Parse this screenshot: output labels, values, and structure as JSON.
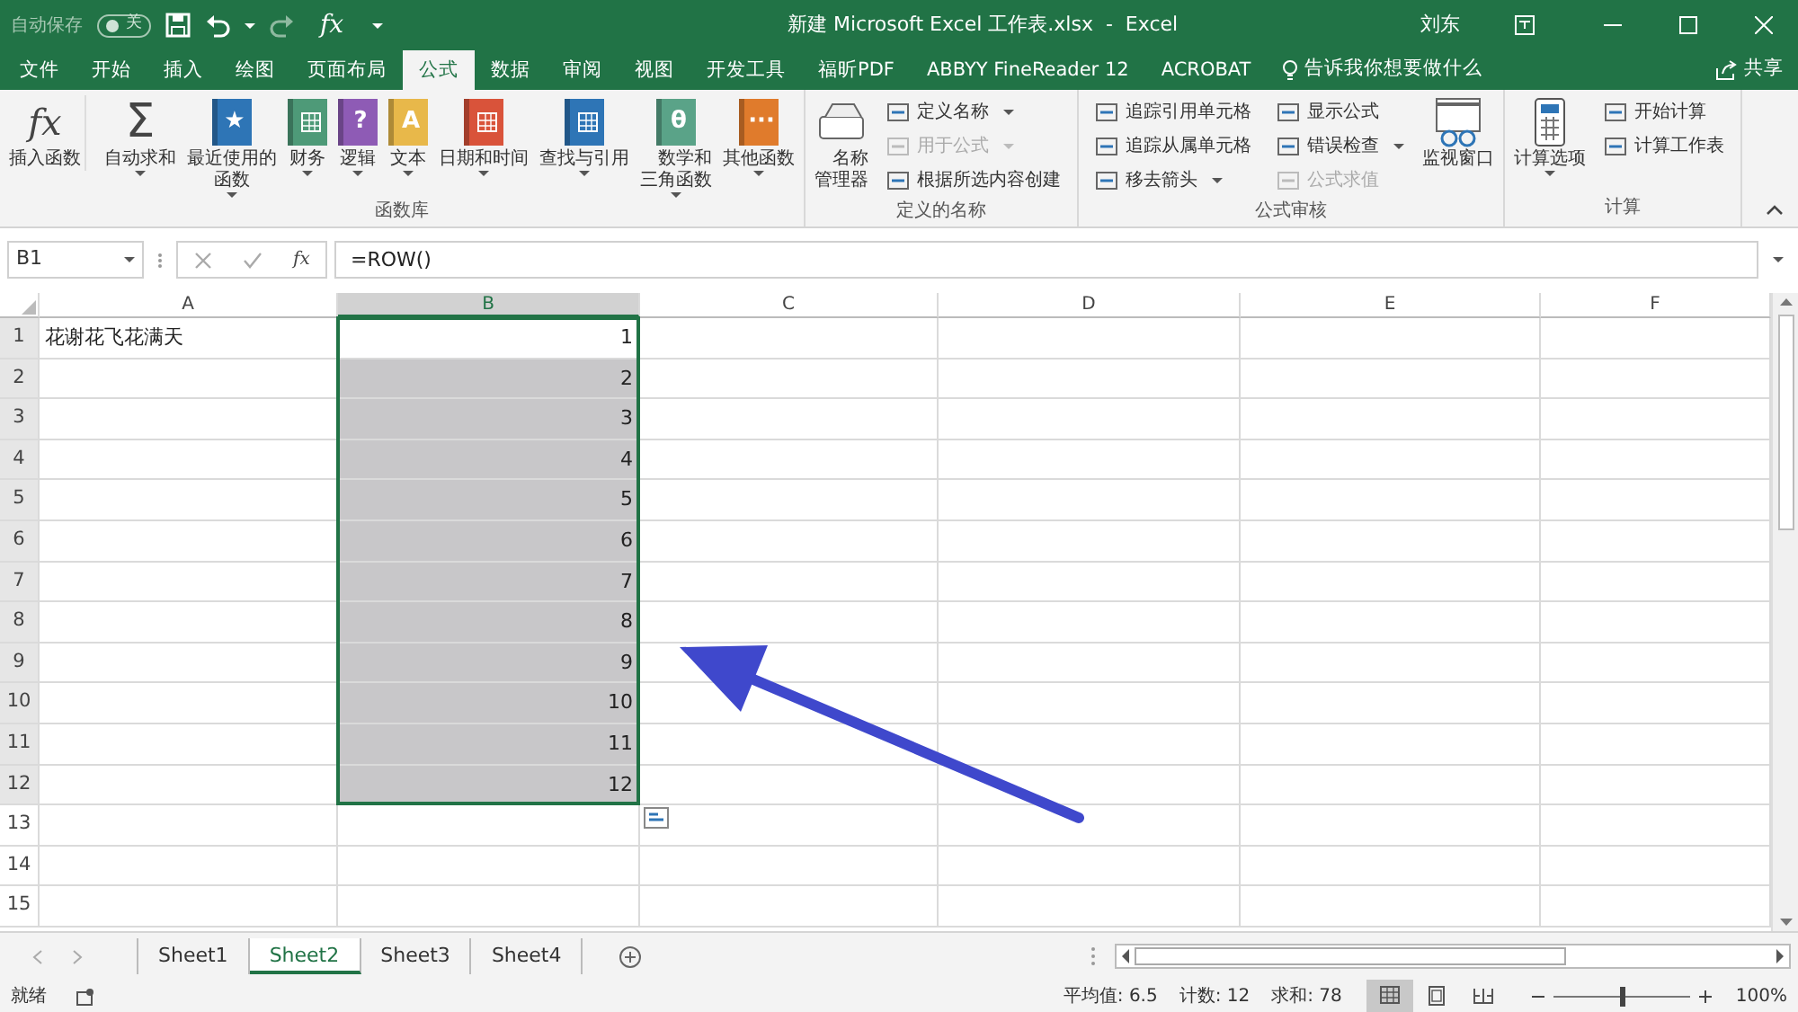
{
  "title_bar": {
    "autosave": {
      "label": "自动保存",
      "on": false,
      "state_text": "关"
    },
    "quick_fx": "fx",
    "title": "新建 Microsoft Excel 工作表.xlsx  -  Excel",
    "user": "刘东"
  },
  "ribbon_tabs": [
    {
      "label": "文件",
      "selected": false
    },
    {
      "label": "开始",
      "selected": false
    },
    {
      "label": "插入",
      "selected": false
    },
    {
      "label": "绘图",
      "selected": false
    },
    {
      "label": "页面布局",
      "selected": false
    },
    {
      "label": "公式",
      "selected": true
    },
    {
      "label": "数据",
      "selected": false
    },
    {
      "label": "审阅",
      "selected": false
    },
    {
      "label": "视图",
      "selected": false
    },
    {
      "label": "开发工具",
      "selected": false
    },
    {
      "label": "福昕PDF",
      "selected": false
    },
    {
      "label": "ABBYY FineReader 12",
      "selected": false
    },
    {
      "label": "ACROBAT",
      "selected": false
    }
  ],
  "tell_me": "告诉我你想要做什么",
  "share": "共享",
  "ribbon_groups": [
    {
      "label": "函数库",
      "items": [
        {
          "kind": "symbol",
          "glyph": "fx",
          "label": "插入函数",
          "dropdown": false
        },
        {
          "kind": "symbol",
          "glyph": "Σ",
          "label": "自动求和",
          "dropdown": true
        },
        {
          "kind": "book",
          "glyph": "★",
          "color": "#2e75b6",
          "label": "最近使用的函数",
          "dropdown": true
        },
        {
          "kind": "book",
          "color": "#4e9a78",
          "label": "财务",
          "dropdown": true
        },
        {
          "kind": "book",
          "glyph": "?",
          "color": "#8e5bb5",
          "label": "逻辑",
          "dropdown": true
        },
        {
          "kind": "book",
          "glyph": "A",
          "color": "#e8b84a",
          "label": "文本",
          "dropdown": true
        },
        {
          "kind": "book",
          "color": "#d9533a",
          "label": "日期和时间",
          "dropdown": true
        },
        {
          "kind": "book",
          "color": "#2e75b6",
          "label": "查找与引用",
          "dropdown": true
        },
        {
          "kind": "book",
          "glyph": "θ",
          "color": "#5aa388",
          "label": "数学和三角函数",
          "dropdown": true
        },
        {
          "kind": "book",
          "glyph": "···",
          "color": "#e07b2c",
          "label": "其他函数",
          "dropdown": true
        }
      ]
    },
    {
      "label": "定义的名称",
      "items": [
        {
          "kind": "drawer",
          "label": "名称管理器",
          "dropdown": false
        },
        {
          "kind": "stack",
          "items": [
            {
              "label": "定义名称",
              "dropdown": true,
              "disabled": false
            },
            {
              "label": "用于公式",
              "dropdown": true,
              "disabled": true
            },
            {
              "label": "根据所选内容创建",
              "dropdown": false,
              "disabled": false
            }
          ]
        }
      ]
    },
    {
      "label": "公式审核",
      "items": [
        {
          "kind": "stack",
          "items": [
            {
              "label": "追踪引用单元格",
              "dropdown": false,
              "disabled": false
            },
            {
              "label": "追踪从属单元格",
              "dropdown": false,
              "disabled": false
            },
            {
              "label": "移去箭头",
              "dropdown": true,
              "disabled": false
            }
          ]
        },
        {
          "kind": "stack",
          "items": [
            {
              "label": "显示公式",
              "dropdown": false,
              "disabled": false
            },
            {
              "label": "错误检查",
              "dropdown": true,
              "disabled": false
            },
            {
              "label": "公式求值",
              "dropdown": false,
              "disabled": true
            }
          ]
        },
        {
          "kind": "window",
          "label": "监视窗口",
          "dropdown": false
        }
      ]
    },
    {
      "label": "计算",
      "items": [
        {
          "kind": "calc",
          "label": "计算选项",
          "dropdown": true
        },
        {
          "kind": "stack",
          "items": [
            {
              "label": "开始计算",
              "dropdown": false,
              "disabled": false
            },
            {
              "label": "计算工作表",
              "dropdown": false,
              "disabled": false
            }
          ]
        }
      ]
    }
  ],
  "formula_bar": {
    "name_box": "B1",
    "fx": "fx",
    "formula": "=ROW()"
  },
  "columns": [
    {
      "label": "A",
      "selected": false
    },
    {
      "label": "B",
      "selected": true
    },
    {
      "label": "C",
      "selected": false
    },
    {
      "label": "D",
      "selected": false
    },
    {
      "label": "E",
      "selected": false
    },
    {
      "label": "F",
      "selected": false
    }
  ],
  "rows": [
    {
      "header": "1",
      "a": "花谢花飞花满天",
      "b": "1",
      "selected": true,
      "active": true
    },
    {
      "header": "2",
      "b": "2",
      "selected": true,
      "active": false
    },
    {
      "header": "3",
      "b": "3",
      "selected": true,
      "active": false
    },
    {
      "header": "4",
      "b": "4",
      "selected": true,
      "active": false
    },
    {
      "header": "5",
      "b": "5",
      "selected": true,
      "active": false
    },
    {
      "header": "6",
      "b": "6",
      "selected": true,
      "active": false
    },
    {
      "header": "7",
      "b": "7",
      "selected": true,
      "active": false
    },
    {
      "header": "8",
      "b": "8",
      "selected": true,
      "active": false
    },
    {
      "header": "9",
      "b": "9",
      "selected": true,
      "active": false
    },
    {
      "header": "10",
      "b": "10",
      "selected": true,
      "active": false
    },
    {
      "header": "11",
      "b": "11",
      "selected": true,
      "active": false
    },
    {
      "header": "12",
      "b": "12",
      "selected": true,
      "active": false
    },
    {
      "header": "13",
      "selected": false,
      "active": false
    },
    {
      "header": "14",
      "selected": false,
      "active": false
    },
    {
      "header": "15",
      "selected": false,
      "active": false
    }
  ],
  "sheets": [
    {
      "label": "Sheet1",
      "selected": false
    },
    {
      "label": "Sheet2",
      "selected": true
    },
    {
      "label": "Sheet3",
      "selected": false
    },
    {
      "label": "Sheet4",
      "selected": false
    }
  ],
  "status_bar": {
    "mode": "就绪",
    "average": "平均值: 6.5",
    "count": "计数: 12",
    "sum": "求和: 78",
    "views": [
      {
        "selected": true
      },
      {
        "selected": false
      },
      {
        "selected": false
      }
    ],
    "zoom": {
      "level": 0.5,
      "label": "100%"
    }
  }
}
